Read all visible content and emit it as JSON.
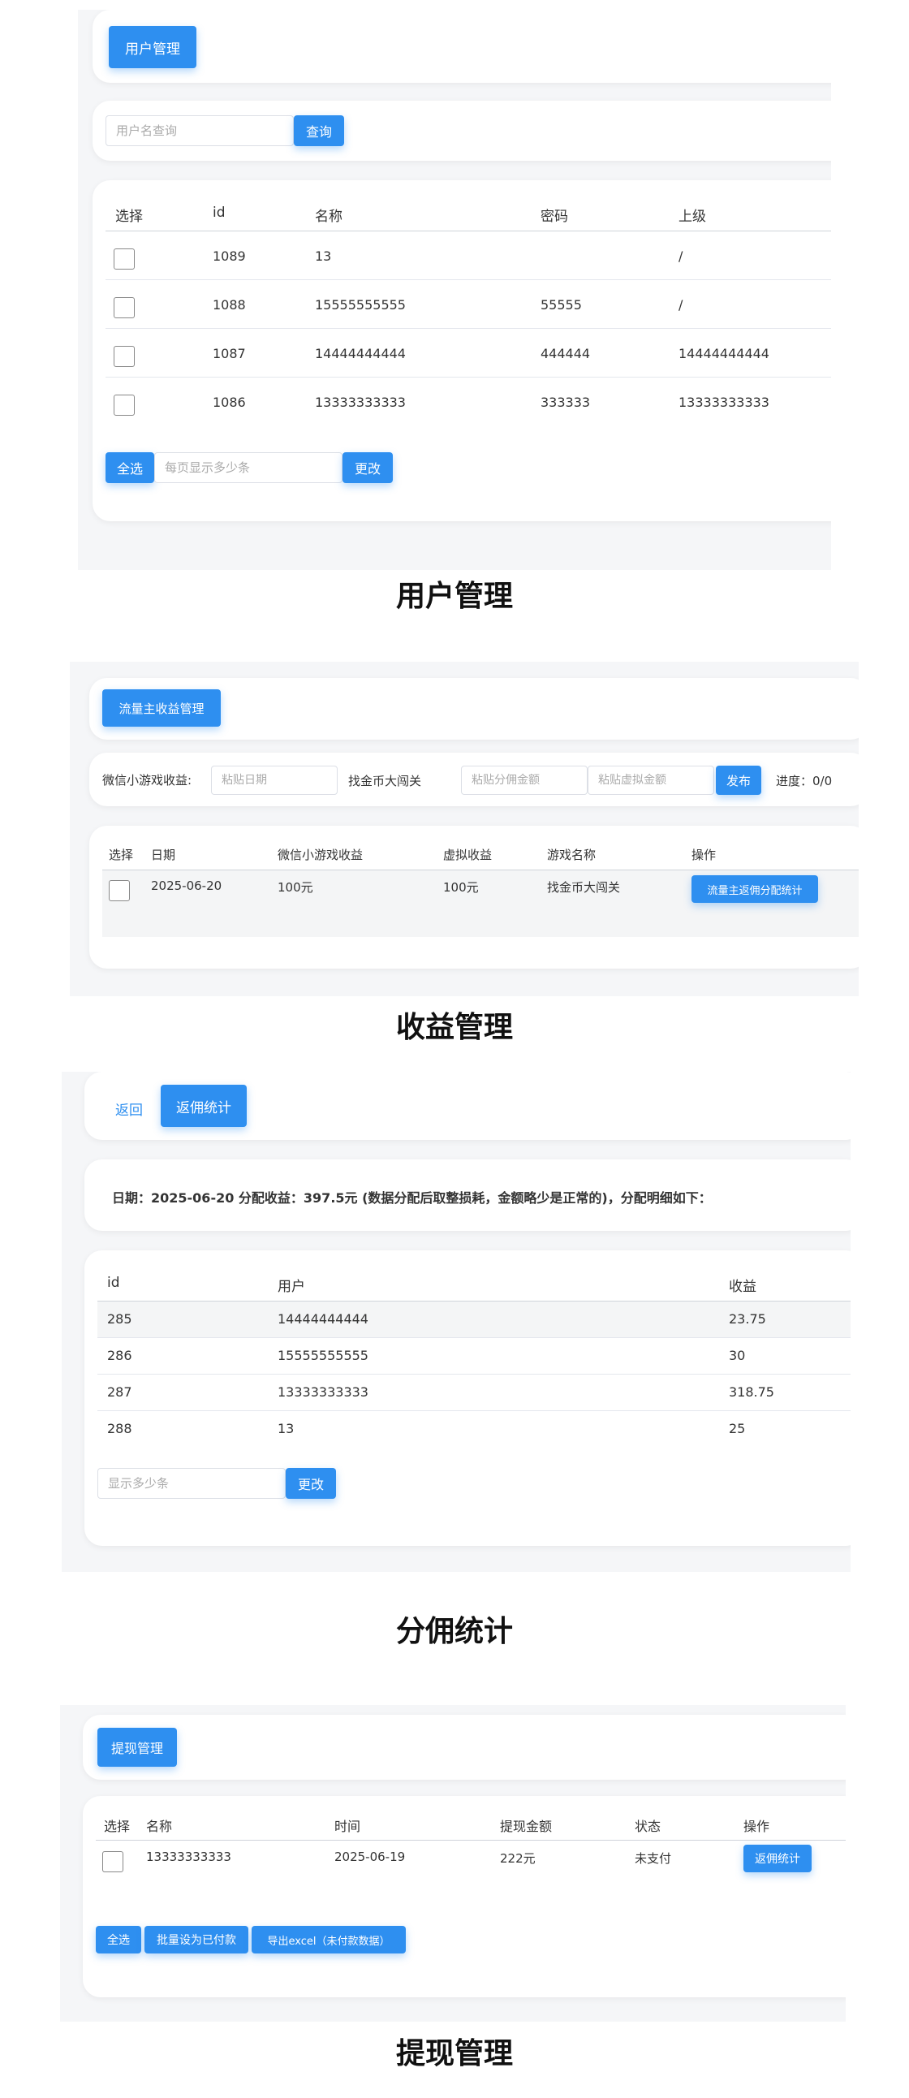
{
  "section1": {
    "header_button": "用户管理",
    "search": {
      "placeholder": "用户名查询",
      "button": "查询"
    },
    "table": {
      "headers": [
        "选择",
        "id",
        "名称",
        "密码",
        "上级"
      ],
      "rows": [
        [
          "1089",
          "13",
          "",
          "/"
        ],
        [
          "1088",
          "15555555555",
          "55555",
          "/"
        ],
        [
          "1087",
          "14444444444",
          "444444",
          "14444444444"
        ],
        [
          "1086",
          "13333333333",
          "333333",
          "13333333333"
        ]
      ]
    },
    "select_all": "全选",
    "page_size_placeholder": "每页显示多少条",
    "change_button": "更改",
    "caption": "用户管理"
  },
  "section2": {
    "header_button": "流量主收益管理",
    "form": {
      "label": "微信小游戏收益:",
      "date_placeholder": "粘贴日期",
      "game_value": "找金币大闯关",
      "amount_placeholder": "粘贴分佣金额",
      "virtual_placeholder": "粘贴虚拟金额",
      "publish_button": "发布",
      "progress": "进度：0/0"
    },
    "table": {
      "headers": [
        "选择",
        "日期",
        "微信小游戏收益",
        "虚拟收益",
        "游戏名称",
        "操作"
      ],
      "rows": [
        {
          "date": "2025-06-20",
          "wx": "100元",
          "virtual": "100元",
          "game": "找金币大闯关",
          "action": "流量主返佣分配统计"
        }
      ]
    },
    "caption": "收益管理"
  },
  "section3": {
    "back_link": "返回",
    "header_button": "返佣统计",
    "summary": "日期：2025-06-20 分配收益：397.5元 (数据分配后取整损耗，金额略少是正常的)，分配明细如下：",
    "table": {
      "headers": [
        "id",
        "用户",
        "收益"
      ],
      "rows": [
        [
          "285",
          "14444444444",
          "23.75"
        ],
        [
          "286",
          "15555555555",
          "30"
        ],
        [
          "287",
          "13333333333",
          "318.75"
        ],
        [
          "288",
          "13",
          "25"
        ]
      ]
    },
    "page_size_placeholder": "显示多少条",
    "change_button": "更改",
    "caption": "分佣统计"
  },
  "section4": {
    "header_button": "提现管理",
    "table": {
      "headers": [
        "选择",
        "名称",
        "时间",
        "提现金额",
        "状态",
        "操作"
      ],
      "rows": [
        {
          "name": "13333333333",
          "time": "2025-06-19",
          "amount": "222元",
          "status": "未支付",
          "action": "返佣统计"
        }
      ]
    },
    "select_all": "全选",
    "batch_paid": "批量设为已付款",
    "export": "导出excel（未付款数据）",
    "caption": "提现管理"
  },
  "colors": {
    "accent": "#2e8ff0",
    "panel_bg": "#f5f6f8",
    "link": "#2e8ff0"
  }
}
